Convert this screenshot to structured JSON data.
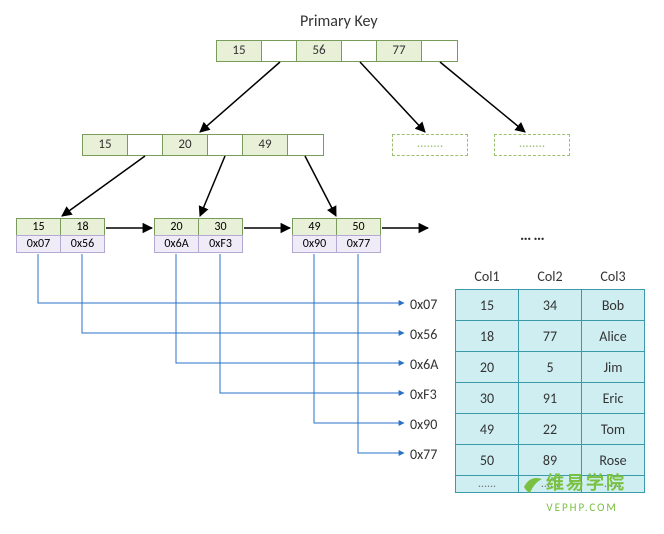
{
  "title": "Primary Key",
  "root_node": {
    "keys": [
      "15",
      "56",
      "77"
    ]
  },
  "mid_node": {
    "keys": [
      "15",
      "20",
      "49"
    ]
  },
  "ghost_nodes": [
    "........",
    "........"
  ],
  "leaves": [
    {
      "keys": [
        "15",
        "18"
      ],
      "ptrs": [
        "0x07",
        "0x56"
      ]
    },
    {
      "keys": [
        "20",
        "30"
      ],
      "ptrs": [
        "0x6A",
        "0xF3"
      ]
    },
    {
      "keys": [
        "49",
        "50"
      ],
      "ptrs": [
        "0x90",
        "0x77"
      ]
    }
  ],
  "leaf_ellipsis": "……",
  "pointer_labels": [
    "0x07",
    "0x56",
    "0x6A",
    "0xF3",
    "0x90",
    "0x77"
  ],
  "table": {
    "headers": [
      "Col1",
      "Col2",
      "Col3"
    ],
    "rows": [
      [
        "15",
        "34",
        "Bob"
      ],
      [
        "18",
        "77",
        "Alice"
      ],
      [
        "20",
        "5",
        "Jim"
      ],
      [
        "30",
        "91",
        "Eric"
      ],
      [
        "49",
        "22",
        "Tom"
      ],
      [
        "50",
        "89",
        "Rose"
      ]
    ],
    "trailing": [
      "......",
      "......",
      "......"
    ]
  },
  "watermark": {
    "line1": "维易学院",
    "line2": "VEPHP.COM"
  }
}
